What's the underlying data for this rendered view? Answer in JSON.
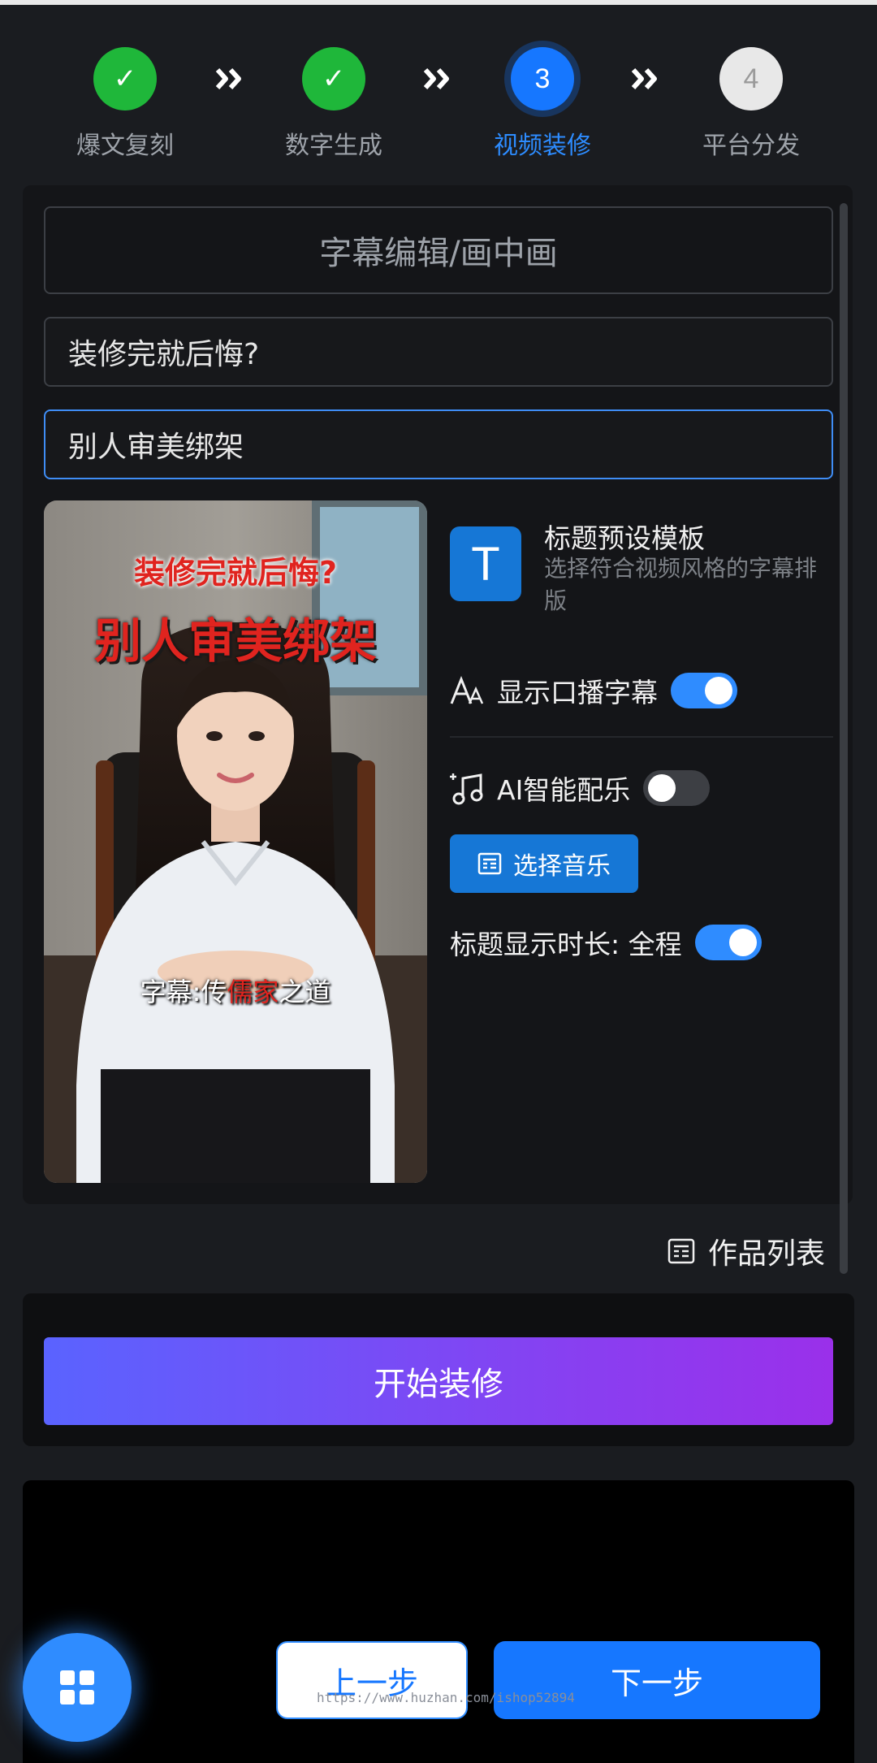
{
  "steps": [
    {
      "label": "爆文复刻",
      "state": "done",
      "mark": "✓"
    },
    {
      "label": "数字生成",
      "state": "done",
      "mark": "✓"
    },
    {
      "label": "视频装修",
      "state": "active",
      "mark": "3"
    },
    {
      "label": "平台分发",
      "state": "todo",
      "mark": "4"
    }
  ],
  "editor": {
    "section_title": "字幕编辑/画中画",
    "subtitle_line1": "装修完就后悔?",
    "subtitle_line2": "别人审美绑架"
  },
  "preview": {
    "overlay_line1": "装修完就后悔?",
    "overlay_line2": "别人审美绑架",
    "caption_prefix": "字幕:传",
    "caption_highlight": "儒家",
    "caption_suffix": "之道"
  },
  "template": {
    "icon_letter": "T",
    "title": "标题预设模板",
    "description": "选择符合视频风格的字幕排版"
  },
  "controls": {
    "show_subtitles_label": "显示口播字幕",
    "show_subtitles_on": true,
    "ai_music_label": "AI智能配乐",
    "ai_music_on": false,
    "choose_music_label": "选择音乐",
    "title_duration_label": "标题显示时长: 全程",
    "title_duration_on": true
  },
  "works_list_label": "作品列表",
  "start_button_label": "开始装修",
  "nav": {
    "prev_label": "上一步",
    "next_label": "下一步"
  },
  "watermark": "https://www.huzhan.com/ishop52894",
  "colors": {
    "accent": "#1677ff",
    "success": "#1fb73a",
    "gradient_start": "#5a63ff",
    "gradient_end": "#9a30ea"
  }
}
